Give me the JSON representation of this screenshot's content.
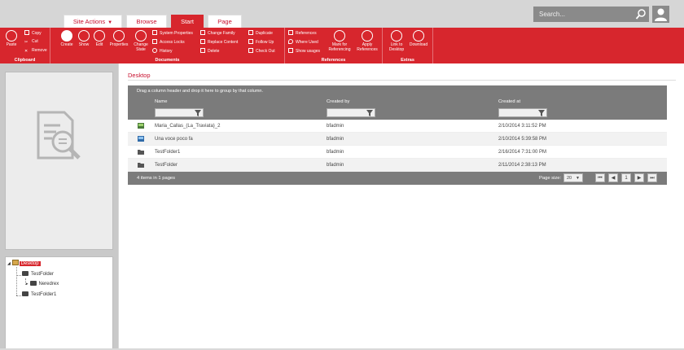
{
  "tabs": [
    {
      "label": "Site Actions",
      "dropdown": true
    },
    {
      "label": "Browse"
    },
    {
      "label": "Start",
      "active": true
    },
    {
      "label": "Page"
    }
  ],
  "search": {
    "placeholder": "Search..."
  },
  "ribbon": {
    "clipboard": {
      "label": "Clipboard",
      "paste": "Paste",
      "copy": "Copy",
      "cut": "Cut",
      "remove": "Remove"
    },
    "documents": {
      "label": "Documents",
      "create": "Create",
      "show": "Show",
      "edit": "Edit",
      "properties": "Properties",
      "change_state": "Change State",
      "system_properties": "System Properties",
      "access_locks": "Access Locks",
      "history": "History",
      "change_family": "Change Family",
      "replace_content": "Replace Content",
      "delete": "Delete",
      "duplicate": "Duplicate",
      "follow_up": "Follow Up",
      "check_out": "Check Out"
    },
    "references": {
      "label": "References",
      "references": "References",
      "where_used": "Where Used",
      "show_usages": "Show usages",
      "mark_for_referencing": "Mark for Referencing",
      "apply_references": "Apply References"
    },
    "extras": {
      "label": "Extras",
      "link_to_desktop": "Link to Desktop",
      "download": "Download"
    }
  },
  "tree": {
    "root": "Desktop",
    "items": [
      "TestFolder",
      "Neredrex",
      "TestFolder1"
    ]
  },
  "main": {
    "breadcrumb": "Desktop",
    "group_hint": "Drag a column header and drop it here to group by that column.",
    "columns": [
      "Name",
      "Created by",
      "Created at"
    ],
    "rows": [
      {
        "icon": "image-file-icon",
        "name": "Maria_Callas_(La_Traviata)_2",
        "created_by": "bfadmin",
        "created_at": "2/10/2014 3:11:52 PM"
      },
      {
        "icon": "audio-file-icon",
        "name": "Una voce poco fa",
        "created_by": "bfadmin",
        "created_at": "2/10/2014 5:39:58 PM"
      },
      {
        "icon": "folder-icon",
        "name": "TestFolder1",
        "created_by": "bfadmin",
        "created_at": "2/16/2014 7:31:00 PM"
      },
      {
        "icon": "folder-icon",
        "name": "TestFolder",
        "created_by": "bfadmin",
        "created_at": "2/11/2014 2:38:13 PM"
      }
    ],
    "footer": {
      "count": "4 items in 1 pages",
      "page_size_label": "Page size:",
      "page_size": "20",
      "current_page": "1"
    }
  },
  "colors": {
    "accent": "#d7262d",
    "grid_header": "#7b7b7b"
  }
}
